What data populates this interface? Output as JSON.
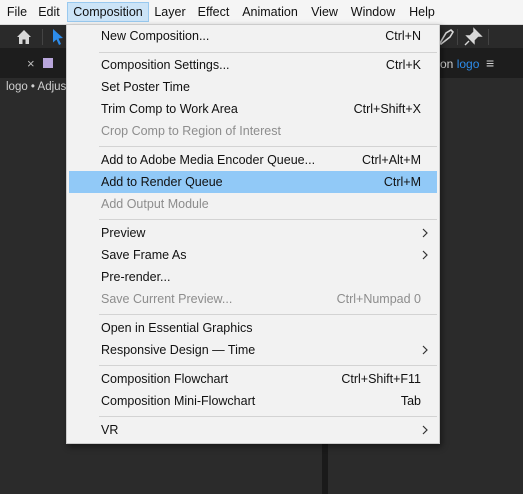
{
  "menubar": {
    "items": [
      {
        "label": "File"
      },
      {
        "label": "Edit"
      },
      {
        "label": "Composition"
      },
      {
        "label": "Layer"
      },
      {
        "label": "Effect"
      },
      {
        "label": "Animation"
      },
      {
        "label": "View"
      },
      {
        "label": "Window"
      },
      {
        "label": "Help"
      }
    ],
    "active": "Composition"
  },
  "panels": {
    "left_tab_label": "logo • Adjus",
    "right_tab_prefix": "on",
    "right_tab_highlight": "logo",
    "right_tab_menu_icon": "hamburger-icon"
  },
  "menu": {
    "items": [
      {
        "label": "New Composition...",
        "shortcut": "Ctrl+N"
      },
      {
        "label": "Composition Settings...",
        "shortcut": "Ctrl+K"
      },
      {
        "label": "Set Poster Time",
        "shortcut": ""
      },
      {
        "label": "Trim Comp to Work Area",
        "shortcut": "Ctrl+Shift+X"
      },
      {
        "label": "Crop Comp to Region of Interest",
        "shortcut": "",
        "disabled": true
      },
      {
        "label": "Add to Adobe Media Encoder Queue...",
        "shortcut": "Ctrl+Alt+M"
      },
      {
        "label": "Add to Render Queue",
        "shortcut": "Ctrl+M",
        "highlighted": true
      },
      {
        "label": "Add Output Module",
        "shortcut": "",
        "disabled": true
      },
      {
        "label": "Preview",
        "shortcut": "",
        "submenu": true
      },
      {
        "label": "Save Frame As",
        "shortcut": "",
        "submenu": true
      },
      {
        "label": "Pre-render...",
        "shortcut": ""
      },
      {
        "label": "Save Current Preview...",
        "shortcut": "Ctrl+Numpad 0",
        "disabled": true
      },
      {
        "label": "Open in Essential Graphics",
        "shortcut": ""
      },
      {
        "label": "Responsive Design — Time",
        "shortcut": "",
        "submenu": true
      },
      {
        "label": "Composition Flowchart",
        "shortcut": "Ctrl+Shift+F11"
      },
      {
        "label": "Composition Mini-Flowchart",
        "shortcut": "Tab"
      },
      {
        "label": "VR",
        "shortcut": "",
        "submenu": true
      }
    ]
  },
  "colors": {
    "highlight": "#91c9f7",
    "menubar_active": "#cce4f7",
    "accent_blue": "#2d8ceb",
    "panel_bg": "#2b2b2b",
    "swatch": "#b9a6dc"
  }
}
